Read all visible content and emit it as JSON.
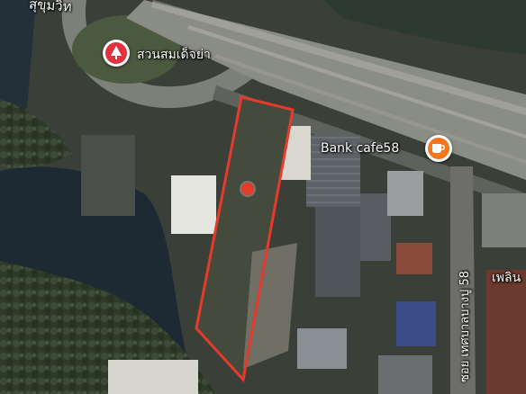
{
  "map": {
    "type": "satellite",
    "road_label": "สุขุมวิท",
    "park_label": "สวนสมเด็จย่า",
    "cafe_label": "Bank cafe58",
    "soi_label": "ซอย เทศบาลบางปู 58",
    "edge_label": "เพลิน",
    "parcel_outline_color": "#e53a2c",
    "park_icon_color": "#e0333f",
    "cafe_icon_color": "#f2761e",
    "marker_color": "#e53a2c",
    "icons": {
      "park": "tree-icon",
      "cafe": "coffee-cup-icon",
      "marker": "location-dot-icon"
    }
  }
}
